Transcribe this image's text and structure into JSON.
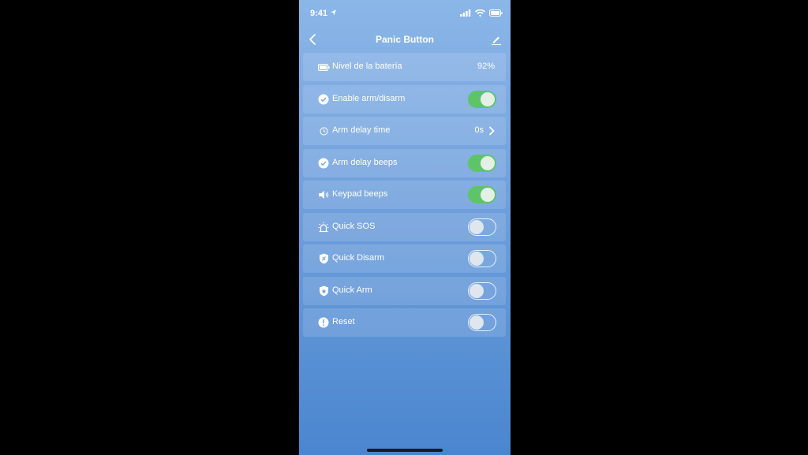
{
  "status_bar": {
    "time": "9:41"
  },
  "nav": {
    "title": "Panic Button"
  },
  "rows": [
    {
      "label": "Nivel de la batería",
      "value": "92%",
      "icon": "battery-icon"
    },
    {
      "label": "Enable arm/disarm",
      "toggle": true,
      "icon": "check-circle-icon"
    },
    {
      "label": "Arm delay time",
      "value": "0s",
      "icon": "clock-icon"
    },
    {
      "label": "Arm delay beeps",
      "toggle": true,
      "icon": "check-circle-icon"
    },
    {
      "label": "Keypad beeps",
      "toggle": true,
      "icon": "speaker-icon"
    },
    {
      "label": "Quick SOS",
      "toggle": false,
      "icon": "siren-icon"
    },
    {
      "label": "Quick Disarm",
      "toggle": false,
      "icon": "shield-disarm-icon"
    },
    {
      "label": "Quick Arm",
      "toggle": false,
      "icon": "shield-home-icon"
    },
    {
      "label": "Reset",
      "toggle": false,
      "icon": "alert-circle-icon"
    }
  ],
  "colors": {
    "toggle_on": "#5ec46a",
    "background_top": "#8bb6e8",
    "background_bottom": "#4a86cf"
  }
}
